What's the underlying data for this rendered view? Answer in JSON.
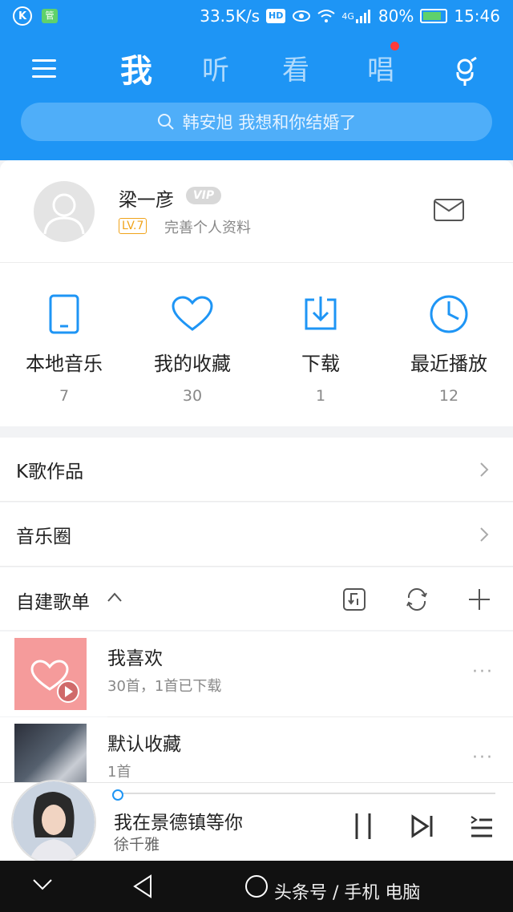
{
  "status_bar": {
    "net_speed": "33.5K/s",
    "hd": "HD",
    "signal": "4G",
    "battery": "80%",
    "time": "15:46",
    "left_icon": "K",
    "app_badge": "管"
  },
  "header": {
    "tabs": [
      {
        "label": "我",
        "active": true
      },
      {
        "label": "听"
      },
      {
        "label": "看"
      },
      {
        "label": "唱"
      }
    ],
    "search_placeholder": "韩安旭 我想和你结婚了"
  },
  "profile": {
    "name": "梁一彦",
    "vip": "VIP",
    "level": "LV.7",
    "complete_text": "完善个人资料"
  },
  "quick_actions": [
    {
      "label": "本地音乐",
      "count": "7",
      "icon": "phone-icon"
    },
    {
      "label": "我的收藏",
      "count": "30",
      "icon": "heart-icon"
    },
    {
      "label": "下载",
      "count": "1",
      "icon": "download-icon"
    },
    {
      "label": "最近播放",
      "count": "12",
      "icon": "clock-icon"
    }
  ],
  "rows": [
    {
      "label": "K歌作品"
    },
    {
      "label": "音乐圈"
    }
  ],
  "playlists": {
    "title": "自建歌单",
    "items": [
      {
        "title": "我喜欢",
        "subtitle": "30首，1首已下载"
      },
      {
        "title": "默认收藏",
        "subtitle": "1首"
      }
    ]
  },
  "player": {
    "song": "我在景德镇等你",
    "artist": "徐千雅",
    "progress": 0.01
  },
  "navbar": {
    "watermark": "头条号 / 手机 电脑"
  },
  "colors": {
    "accent": "#1e95f5",
    "level": "#f0a31a",
    "dot": "#ff3b3b"
  }
}
